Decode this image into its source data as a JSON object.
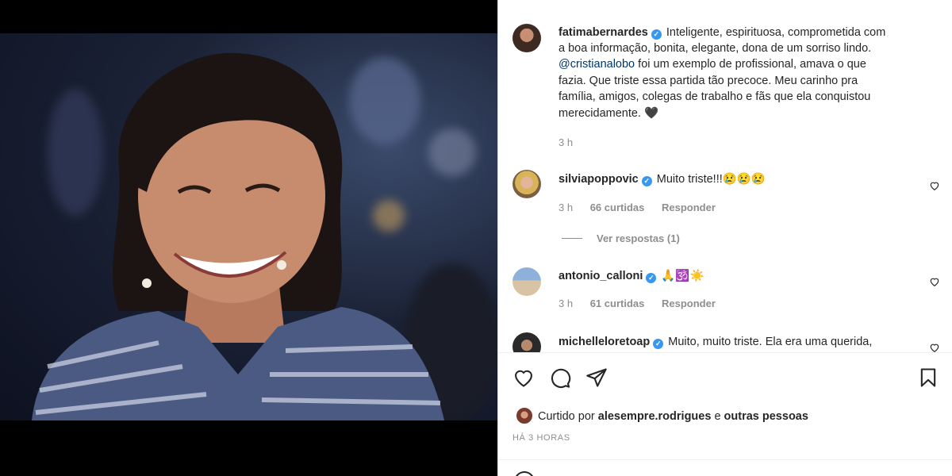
{
  "post": {
    "author": "fatimabernardes",
    "caption_line1": "Inteligente, espirituosa, comprometida com",
    "caption_line2": "a boa informação, bonita, elegante, dona de um sorriso lindo.",
    "caption_mention": "@cristianalobo",
    "caption_line3_rest": " foi um exemplo de profissional, amava o que",
    "caption_line4": "fazia. Que triste essa partida tão precoce. Meu carinho pra",
    "caption_line5": "família, amigos, colegas de trabalho e fãs que ela conquistou",
    "caption_line6": "merecidamente. 🖤",
    "time": "3 h"
  },
  "comments": [
    {
      "username": "silviapoppovic",
      "text": "Muito triste!!!😢😢😢",
      "time": "3 h",
      "likes": "66 curtidas",
      "reply": "Responder"
    },
    {
      "username": "antonio_calloni",
      "text": "🙏🕉️☀️",
      "time": "3 h",
      "likes": "61 curtidas",
      "reply": "Responder"
    },
    {
      "username": "michelleloretoap",
      "text": "Muito, muito triste. Ela era uma querida,"
    }
  ],
  "view_replies": "Ver respostas (1)",
  "liked_by": {
    "prefix": "Curtido por ",
    "user": "alesempre.rodrigues",
    "middle": " e ",
    "others": "outras pessoas"
  },
  "posted_ago": "HÁ 3 HORAS",
  "colors": {
    "verified": "#3897f0",
    "mention": "#00376b",
    "muted": "#8e8e8e"
  },
  "icons": [
    "heart-icon",
    "comment-icon",
    "share-icon",
    "bookmark-icon",
    "verified-icon",
    "emoji-icon"
  ]
}
